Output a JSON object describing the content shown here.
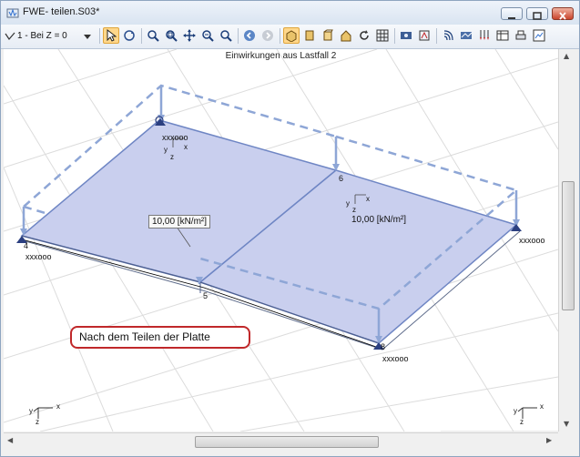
{
  "window": {
    "title": "FWE- teilen.S03*"
  },
  "toolbar": {
    "view_select": "1 - Bei Z = 0"
  },
  "canvas": {
    "heading": "Einwirkungen aus Lastfall 2",
    "load_label_left": "10,00 [kN/m²]",
    "load_label_right": "10,00 [kN/m²]",
    "node_labels": {
      "n4": "4",
      "n5": "5",
      "n6": "6",
      "n8": "8"
    },
    "support_labels": {
      "left": "xxxooo",
      "right": "xxxooo",
      "bottom": "xxxooo",
      "top": "xxxooo"
    },
    "axis": {
      "x": "x",
      "y": "y",
      "z": "z"
    },
    "callout": "Nach dem Teilen der Platte"
  },
  "colors": {
    "plate_fill": "#c9cfee",
    "plate_edge": "#6f86c4",
    "load": "#8ea6d6",
    "callout_border": "#c0282a",
    "grid": "#dcdcdc"
  }
}
